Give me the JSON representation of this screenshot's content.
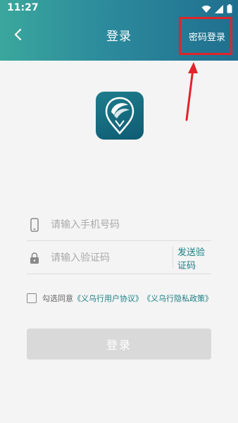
{
  "status_bar": {
    "time": "11:27"
  },
  "header": {
    "title": "登录",
    "password_login_label": "密码登录"
  },
  "form": {
    "phone_placeholder": "请输入手机号码",
    "code_placeholder": "请输入验证码",
    "send_code_label": "发送验证码"
  },
  "agreement": {
    "prefix": "勾选同意",
    "user_agreement": "《义乌行用户协议》",
    "privacy_policy": "《义乌行隐私政策》"
  },
  "login_button_label": "登录",
  "colors": {
    "header_start": "#3aa79c",
    "header_end": "#1f6f8f",
    "accent": "#1b7f86",
    "annotation": "#e0242b",
    "disabled_button": "#d9d9d9"
  }
}
